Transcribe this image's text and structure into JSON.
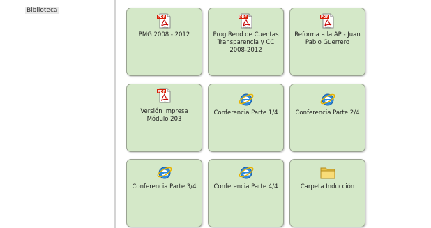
{
  "sidebar": {
    "title": "Biblioteca"
  },
  "tiles": [
    {
      "label": "PMG 2008 - 2012",
      "icon": "pdf-icon"
    },
    {
      "label": "Prog.Rend de Cuentas Transparencia y CC 2008-2012",
      "icon": "pdf-icon"
    },
    {
      "label": "Reforma a la AP - Juan Pablo Guerrero",
      "icon": "pdf-icon"
    },
    {
      "label": "Versión Impresa Módulo 203",
      "icon": "pdf-icon"
    },
    {
      "label": "Conferencia Parte 1/4",
      "icon": "internet-explorer-icon"
    },
    {
      "label": "Conferencia Parte 2/4",
      "icon": "internet-explorer-icon"
    },
    {
      "label": "Conferencia Parte 3/4",
      "icon": "internet-explorer-icon"
    },
    {
      "label": "Conferencia Parte 4/4",
      "icon": "internet-explorer-icon"
    },
    {
      "label": "Carpeta Inducción",
      "icon": "folder-icon"
    }
  ],
  "colors": {
    "tile_bg": "#d4e8c8",
    "tile_border": "#9aa392"
  },
  "icon_text": {
    "pdf": "PDF",
    "adobe": "Adobe"
  }
}
